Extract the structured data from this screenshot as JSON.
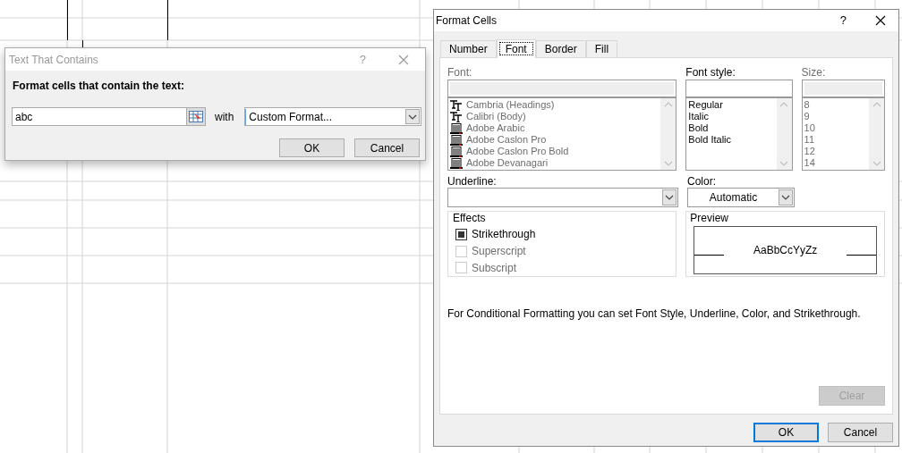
{
  "text_contains_dialog": {
    "title": "Text That Contains",
    "active": false,
    "help": "?",
    "prompt": "Format cells that contain the text:",
    "value": "abc",
    "with_label": "with",
    "format_value": "Custom Format...",
    "buttons": [
      "OK",
      "Cancel"
    ]
  },
  "format_cells": {
    "title": "Format Cells",
    "help": "?",
    "tabs": [
      {
        "label": "Number",
        "selected": false
      },
      {
        "label": "Font",
        "selected": true
      },
      {
        "label": "Border",
        "selected": false
      },
      {
        "label": "Fill",
        "selected": false
      }
    ],
    "font": {
      "label": "Font:",
      "disabled": true,
      "items": [
        {
          "name": "Cambria (Headings)",
          "kind": "truetype"
        },
        {
          "name": "Calibri (Body)",
          "kind": "truetype"
        },
        {
          "name": "Adobe Arabic",
          "kind": "printer"
        },
        {
          "name": "Adobe Caslon Pro",
          "kind": "printer"
        },
        {
          "name": "Adobe Caslon Pro Bold",
          "kind": "printer"
        },
        {
          "name": "Adobe Devanagari",
          "kind": "printer"
        }
      ]
    },
    "font_style": {
      "label": "Font style:",
      "disabled": false,
      "items": [
        "Regular",
        "Italic",
        "Bold",
        "Bold Italic"
      ]
    },
    "size": {
      "label": "Size:",
      "disabled": true,
      "items": [
        "8",
        "9",
        "10",
        "11",
        "12",
        "14"
      ]
    },
    "underline": {
      "label": "Underline:"
    },
    "color": {
      "label": "Color:",
      "value": "Automatic"
    },
    "effects": {
      "label": "Effects",
      "options": [
        {
          "label": "Strikethrough",
          "checked": true,
          "disabled": false
        },
        {
          "label": "Superscript",
          "checked": false,
          "disabled": true
        },
        {
          "label": "Subscript",
          "checked": false,
          "disabled": true
        }
      ]
    },
    "preview": {
      "label": "Preview",
      "sample": "AaBbCcYyZz"
    },
    "note": "For Conditional Formatting you can set Font Style, Underline, Color, and Strikethrough.",
    "clear_button": {
      "label": "Clear",
      "disabled": true
    },
    "buttons": [
      {
        "label": "OK",
        "default": true
      },
      {
        "label": "Cancel",
        "default": false
      }
    ]
  }
}
